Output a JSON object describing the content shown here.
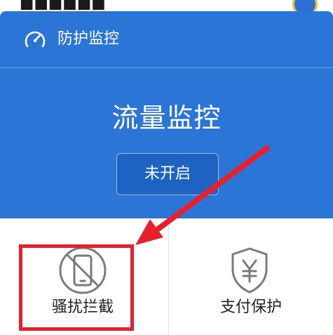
{
  "header": {
    "title": "防护监控",
    "icon": "gauge-icon"
  },
  "hero": {
    "feature_title": "流量监控",
    "status_button_label": "未开启"
  },
  "tiles": [
    {
      "label": "骚扰拦截",
      "icon": "phone-blocked-icon"
    },
    {
      "label": "支付保护",
      "icon": "yuan-shield-icon"
    }
  ],
  "colors": {
    "hero_blue": "#2a75d6",
    "button_blue": "#1f63c2",
    "annotation_red": "#e8202b",
    "icon_gray": "#7a7a7a"
  }
}
